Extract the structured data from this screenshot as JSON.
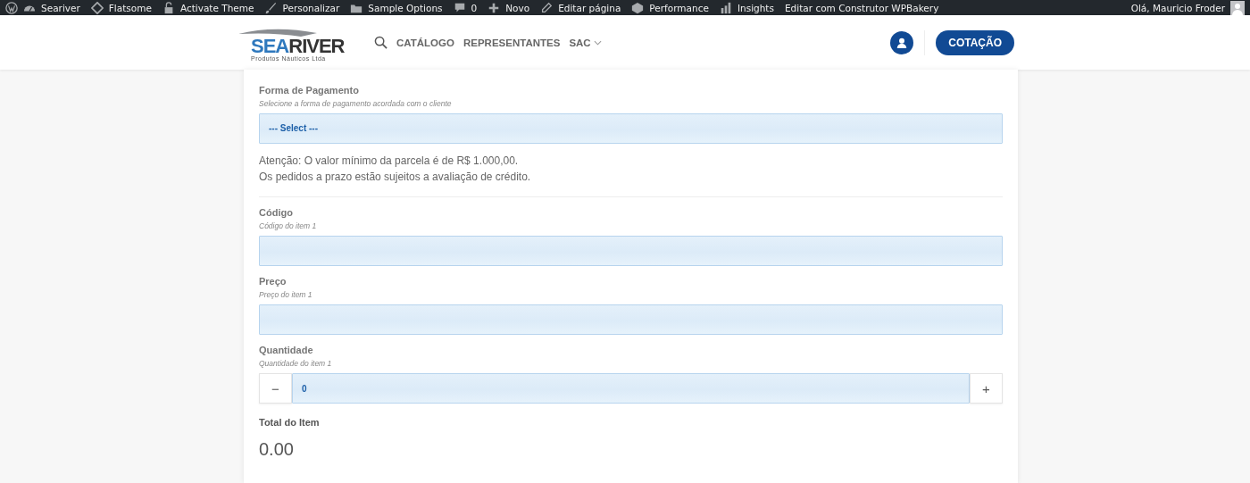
{
  "admin_bar": {
    "items": [
      {
        "label": "Seariver"
      },
      {
        "label": "Flatsome"
      },
      {
        "label": "Activate Theme"
      },
      {
        "label": "Personalizar"
      },
      {
        "label": "Sample Options"
      },
      {
        "label": "0"
      },
      {
        "label": "Novo"
      },
      {
        "label": "Editar página"
      },
      {
        "label": "Performance"
      },
      {
        "label": "Insights"
      },
      {
        "label": "Editar com Construtor WPBakery"
      }
    ],
    "greeting": "Olá, Mauricio Froder"
  },
  "header": {
    "logo": {
      "part_1": "SEA",
      "part_2": "RIVER",
      "tagline": "Produtos Náuticos Ltda"
    },
    "nav": [
      {
        "label": "CATÁLOGO"
      },
      {
        "label": "REPRESENTANTES"
      },
      {
        "label": "SAC",
        "dropdown": true
      }
    ],
    "button": "COTAÇÃO"
  },
  "form": {
    "sections": [
      {
        "kind": "select",
        "label": "Forma de Pagamento",
        "description": "Selecione a forma de pagamento acordada com o cliente",
        "value": "--- Select ---",
        "notes": [
          "Atenção: O valor mínimo da parcela é de R$ 1.000,00.",
          "Os pedidos a prazo estão sujeitos a avaliação de crédito."
        ]
      },
      {
        "kind": "text",
        "label": "Código",
        "description": "Código do item 1"
      },
      {
        "kind": "text",
        "label": "Preço",
        "description": "Preço do item 1"
      },
      {
        "kind": "stepper",
        "label": "Quantidade",
        "description": "Quantidade do item 1",
        "value": "0",
        "minus": "−",
        "plus": "+"
      },
      {
        "kind": "total",
        "label": "Total do Item",
        "value": "0.00"
      }
    ]
  }
}
